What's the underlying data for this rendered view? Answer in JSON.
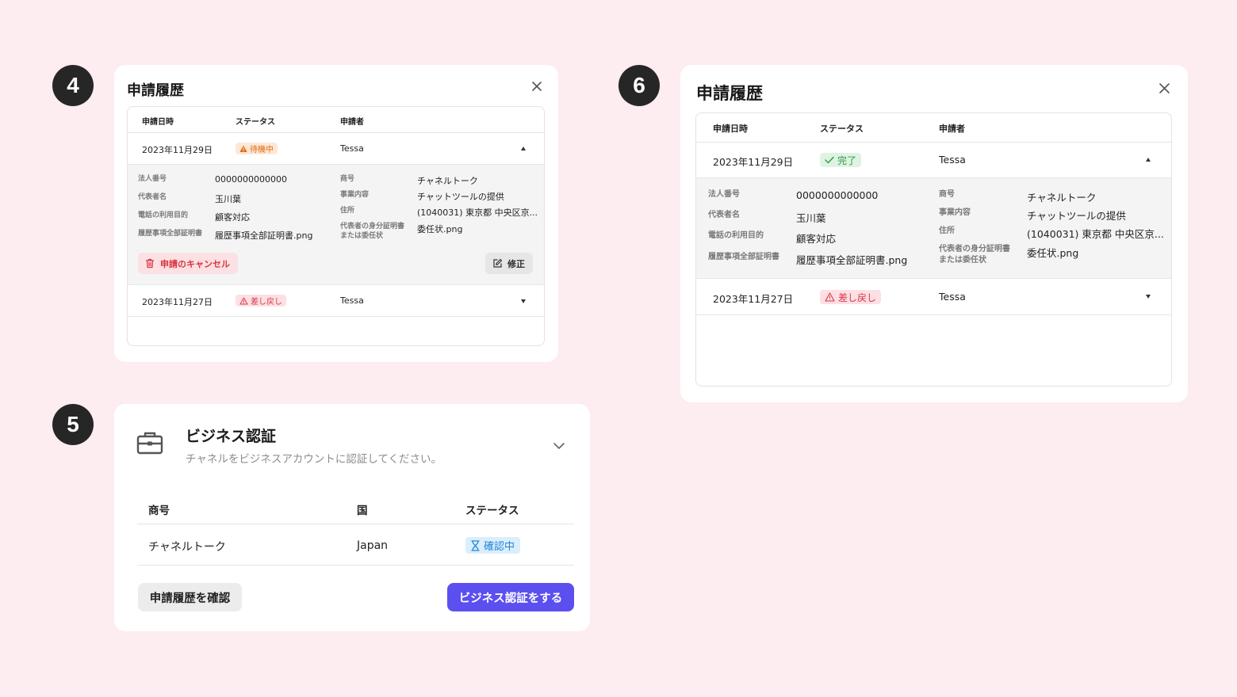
{
  "steps": [
    "4",
    "5",
    "6"
  ],
  "history_small": {
    "title": "申請履歴",
    "headers": {
      "date": "申請日時",
      "status": "ステータス",
      "applicant": "申請者"
    },
    "rows": [
      {
        "date": "2023年11月29日",
        "status": "待機中",
        "applicant": "Tessa"
      },
      {
        "date": "2023年11月27日",
        "status": "差し戻し",
        "applicant": "Tessa"
      }
    ],
    "detail": {
      "corp_number_label": "法人番号",
      "corp_number": "0000000000000",
      "rep_label": "代表者名",
      "rep": "玉川葉",
      "purpose_label": "電話の利用目的",
      "purpose": "顧客対応",
      "cert_label": "履歴事項全部証明書",
      "cert": "履歴事項全部証明書.png",
      "trade_label": "商号",
      "trade": "チャネルトーク",
      "business_label": "事業内容",
      "business": "チャットツールの提供",
      "address_label": "住所",
      "address": "(1040031) 東京都 中央区京...",
      "id_label_1": "代表者の身分証明書",
      "id_label_2": "または委任状",
      "id_file": "委任状.png"
    },
    "cancel_label": "申請のキャンセル",
    "edit_label": "修正"
  },
  "history_large": {
    "title": "申請履歴",
    "headers": {
      "date": "申請日時",
      "status": "ステータス",
      "applicant": "申請者"
    },
    "rows": [
      {
        "date": "2023年11月29日",
        "status": "完了",
        "applicant": "Tessa"
      },
      {
        "date": "2023年11月27日",
        "status": "差し戻し",
        "applicant": "Tessa"
      }
    ],
    "detail": {
      "corp_number_label": "法人番号",
      "corp_number": "0000000000000",
      "rep_label": "代表者名",
      "rep": "玉川葉",
      "purpose_label": "電話の利用目的",
      "purpose": "顧客対応",
      "cert_label": "履歴事項全部証明書",
      "cert": "履歴事項全部証明書.png",
      "trade_label": "商号",
      "trade": "チャネルトーク",
      "business_label": "事業内容",
      "business": "チャットツールの提供",
      "address_label": "住所",
      "address": "(1040031) 東京都 中央区京...",
      "id_label_1": "代表者の身分証明書",
      "id_label_2": "または委任状",
      "id_file": "委任状.png"
    }
  },
  "business_verify": {
    "title": "ビジネス認証",
    "subtitle": "チャネルをビジネスアカウントに認証してください。",
    "headers": {
      "trade_name": "商号",
      "country": "国",
      "status": "ステータス"
    },
    "row": {
      "trade_name": "チャネルトーク",
      "country": "Japan",
      "status": "確認中"
    },
    "history_button": "申請履歴を確認",
    "verify_button": "ビジネス認証をする"
  },
  "colors": {
    "background": "#fdecf0",
    "primary": "#5b4ff0",
    "warning": "#e46a10",
    "danger": "#d9374a",
    "success": "#2f9a48",
    "info": "#2386d6"
  }
}
